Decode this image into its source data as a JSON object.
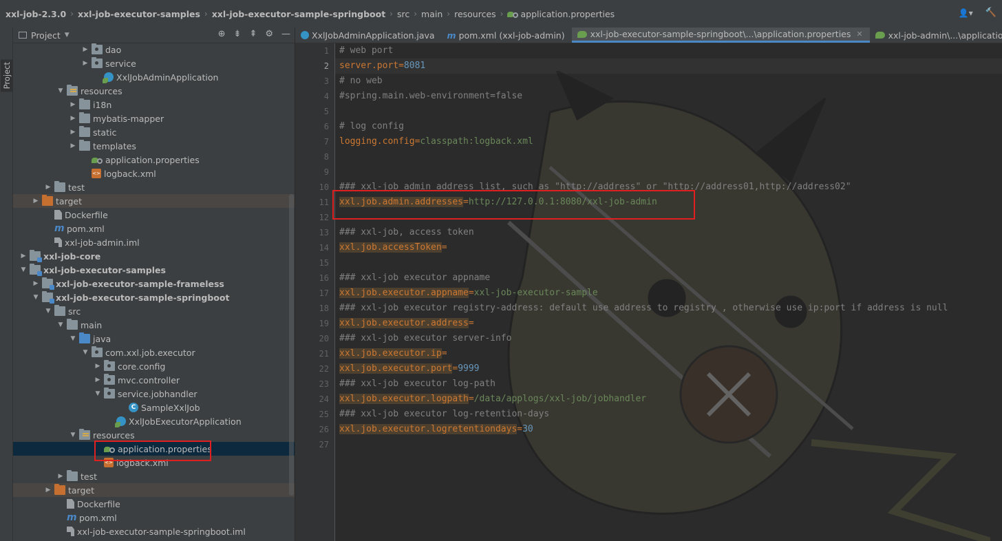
{
  "breadcrumb": [
    {
      "label": "xxl-job-2.3.0",
      "bold": true
    },
    {
      "label": "xxl-job-executor-samples",
      "bold": true
    },
    {
      "label": "xxl-job-executor-sample-springboot",
      "bold": true
    },
    {
      "label": "src",
      "bold": false
    },
    {
      "label": "main",
      "bold": false
    },
    {
      "label": "resources",
      "bold": false
    },
    {
      "label": "application.properties",
      "bold": false
    }
  ],
  "tool_stripe": {
    "label": "Project"
  },
  "project_panel": {
    "title": "Project"
  },
  "tree": [
    {
      "label": "dao",
      "icon": "folder-package",
      "depth": 6,
      "arrow": "right"
    },
    {
      "label": "service",
      "icon": "folder-package",
      "depth": 6,
      "arrow": "right"
    },
    {
      "label": "XxlJobAdminApplication",
      "icon": "spring-class",
      "depth": 7,
      "arrow": "none"
    },
    {
      "label": "resources",
      "icon": "folder-resources",
      "depth": 4,
      "arrow": "down"
    },
    {
      "label": "i18n",
      "icon": "folder",
      "depth": 5,
      "arrow": "right"
    },
    {
      "label": "mybatis-mapper",
      "icon": "folder",
      "depth": 5,
      "arrow": "right"
    },
    {
      "label": "static",
      "icon": "folder",
      "depth": 5,
      "arrow": "right"
    },
    {
      "label": "templates",
      "icon": "folder",
      "depth": 5,
      "arrow": "right"
    },
    {
      "label": "application.properties",
      "icon": "properties",
      "depth": 6,
      "arrow": "none"
    },
    {
      "label": "logback.xml",
      "icon": "xml",
      "depth": 6,
      "arrow": "none"
    },
    {
      "label": "test",
      "icon": "folder",
      "depth": 3,
      "arrow": "right"
    },
    {
      "label": "target",
      "icon": "folder-orange",
      "depth": 2,
      "arrow": "right",
      "dim": true
    },
    {
      "label": "Dockerfile",
      "icon": "file",
      "depth": 3,
      "arrow": "none"
    },
    {
      "label": "pom.xml",
      "icon": "maven",
      "depth": 3,
      "arrow": "none"
    },
    {
      "label": "xxl-job-admin.iml",
      "icon": "iml",
      "depth": 3,
      "arrow": "none"
    },
    {
      "label": "xxl-job-core",
      "icon": "folder-module",
      "depth": 1,
      "arrow": "right",
      "bold": true
    },
    {
      "label": "xxl-job-executor-samples",
      "icon": "folder-module",
      "depth": 1,
      "arrow": "down",
      "bold": true
    },
    {
      "label": "xxl-job-executor-sample-frameless",
      "icon": "folder-module",
      "depth": 2,
      "arrow": "right",
      "bold": true
    },
    {
      "label": "xxl-job-executor-sample-springboot",
      "icon": "folder-module",
      "depth": 2,
      "arrow": "down",
      "bold": true
    },
    {
      "label": "src",
      "icon": "folder",
      "depth": 3,
      "arrow": "down"
    },
    {
      "label": "main",
      "icon": "folder",
      "depth": 4,
      "arrow": "down"
    },
    {
      "label": "java",
      "icon": "folder-source",
      "depth": 5,
      "arrow": "down"
    },
    {
      "label": "com.xxl.job.executor",
      "icon": "folder-package",
      "depth": 6,
      "arrow": "down"
    },
    {
      "label": "core.config",
      "icon": "folder-package",
      "depth": 7,
      "arrow": "right"
    },
    {
      "label": "mvc.controller",
      "icon": "folder-package",
      "depth": 7,
      "arrow": "right"
    },
    {
      "label": "service.jobhandler",
      "icon": "folder-package",
      "depth": 7,
      "arrow": "down"
    },
    {
      "label": "SampleXxlJob",
      "icon": "class",
      "depth": 9,
      "arrow": "none"
    },
    {
      "label": "XxlJobExecutorApplication",
      "icon": "spring-class",
      "depth": 8,
      "arrow": "none"
    },
    {
      "label": "resources",
      "icon": "folder-resources",
      "depth": 5,
      "arrow": "down"
    },
    {
      "label": "application.properties",
      "icon": "properties",
      "depth": 7,
      "arrow": "none",
      "selected": true
    },
    {
      "label": "logback.xml",
      "icon": "xml",
      "depth": 7,
      "arrow": "none"
    },
    {
      "label": "test",
      "icon": "folder",
      "depth": 4,
      "arrow": "right"
    },
    {
      "label": "target",
      "icon": "folder-orange",
      "depth": 3,
      "arrow": "right",
      "dim": true
    },
    {
      "label": "Dockerfile",
      "icon": "file",
      "depth": 4,
      "arrow": "none"
    },
    {
      "label": "pom.xml",
      "icon": "maven",
      "depth": 4,
      "arrow": "none"
    },
    {
      "label": "xxl-job-executor-sample-springboot.iml",
      "icon": "iml",
      "depth": 4,
      "arrow": "none"
    }
  ],
  "tabs": [
    {
      "label": "XxlJobAdminApplication.java",
      "icon": "class-icon",
      "active": false,
      "close": false
    },
    {
      "label": "pom.xml (xxl-job-admin)",
      "icon": "maven-icon",
      "active": false,
      "close": false
    },
    {
      "label": "xxl-job-executor-sample-springboot\\...\\application.properties",
      "icon": "properties-icon",
      "active": true,
      "close": true
    },
    {
      "label": "xxl-job-admin\\...\\application.properties",
      "icon": "properties-icon",
      "active": false,
      "close": false
    }
  ],
  "editor": {
    "current_line": 2,
    "lines": [
      [
        {
          "t": "# web port",
          "c": "cm"
        }
      ],
      [
        {
          "t": "server.port",
          "c": "plain"
        },
        {
          "t": "=",
          "c": "eq"
        },
        {
          "t": "8081",
          "c": "num"
        }
      ],
      [
        {
          "t": "# no web",
          "c": "cm"
        }
      ],
      [
        {
          "t": "#spring.main.web-environment=false",
          "c": "cm"
        }
      ],
      [],
      [
        {
          "t": "# log config",
          "c": "cm"
        }
      ],
      [
        {
          "t": "logging.config",
          "c": "plain"
        },
        {
          "t": "=",
          "c": "eq"
        },
        {
          "t": "classpath:logback.xml",
          "c": "val"
        }
      ],
      [],
      [],
      [
        {
          "t": "### xxl-job admin address list, such as \"http://address\" or \"http://address01,http://address02\"",
          "c": "cm"
        }
      ],
      [
        {
          "t": "xxl.job.admin.addresses",
          "c": "key"
        },
        {
          "t": "=",
          "c": "eq"
        },
        {
          "t": "http://127.0.0.1:8080/xxl-job-admin",
          "c": "val"
        }
      ],
      [],
      [
        {
          "t": "### xxl-job, access token",
          "c": "cm"
        }
      ],
      [
        {
          "t": "xxl.job.accessToken",
          "c": "key"
        },
        {
          "t": "=",
          "c": "eq"
        }
      ],
      [],
      [
        {
          "t": "### xxl-job executor appname",
          "c": "cm"
        }
      ],
      [
        {
          "t": "xxl.job.executor.appname",
          "c": "key"
        },
        {
          "t": "=",
          "c": "eq"
        },
        {
          "t": "xxl-job-executor-sample",
          "c": "val"
        }
      ],
      [
        {
          "t": "### xxl-job executor registry-address: default use address to registry , otherwise use ip:port if address is null",
          "c": "cm"
        }
      ],
      [
        {
          "t": "xxl.job.executor.address",
          "c": "key"
        },
        {
          "t": "=",
          "c": "eq"
        }
      ],
      [
        {
          "t": "### xxl-job executor server-info",
          "c": "cm"
        }
      ],
      [
        {
          "t": "xxl.job.executor.ip",
          "c": "key"
        },
        {
          "t": "=",
          "c": "eq"
        }
      ],
      [
        {
          "t": "xxl.job.executor.port",
          "c": "key"
        },
        {
          "t": "=",
          "c": "eq"
        },
        {
          "t": "9999",
          "c": "num"
        }
      ],
      [
        {
          "t": "### xxl-job executor log-path",
          "c": "cm"
        }
      ],
      [
        {
          "t": "xxl.job.executor.logpath",
          "c": "key"
        },
        {
          "t": "=",
          "c": "eq"
        },
        {
          "t": "/data/applogs/xxl-job/jobhandler",
          "c": "val"
        }
      ],
      [
        {
          "t": "### xxl-job executor log-retention-days",
          "c": "cm"
        }
      ],
      [
        {
          "t": "xxl.job.executor.logretentiondays",
          "c": "key"
        },
        {
          "t": "=",
          "c": "eq"
        },
        {
          "t": "30",
          "c": "num"
        }
      ],
      []
    ]
  }
}
